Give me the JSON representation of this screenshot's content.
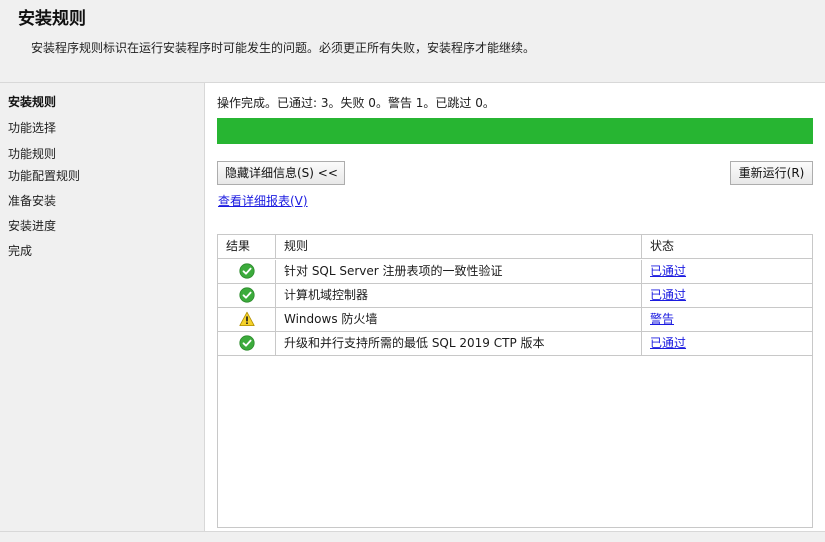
{
  "header": {
    "title": "安装规则",
    "description": "安装程序规则标识在运行安装程序时可能发生的问题。必须更正所有失败，安装程序才能继续。"
  },
  "sidebar": {
    "items": [
      {
        "label": "安装规则",
        "active": true
      },
      {
        "label": "功能选择",
        "active": false
      },
      {
        "label": "功能规则",
        "active": false
      },
      {
        "label": "功能配置规则",
        "active": false
      },
      {
        "label": "准备安装",
        "active": false
      },
      {
        "label": "安装进度",
        "active": false
      },
      {
        "label": "完成",
        "active": false
      }
    ]
  },
  "main": {
    "status_text": "操作完成。已通过: 3。失败 0。警告 1。已跳过 0。",
    "progress_percent": 100,
    "progress_color": "#27b532",
    "hide_details_label": "隐藏详细信息(S) <<",
    "rerun_label": "重新运行(R)",
    "report_link": "查看详细报表(V)",
    "table": {
      "headers": [
        "结果",
        "规则",
        "状态"
      ],
      "rows": [
        {
          "icon": "check-circle-icon",
          "rule": "针对 SQL Server 注册表项的一致性验证",
          "status": "已通过"
        },
        {
          "icon": "check-circle-icon",
          "rule": "计算机域控制器",
          "status": "已通过"
        },
        {
          "icon": "warning-icon",
          "rule": "Windows 防火墙",
          "status": "警告"
        },
        {
          "icon": "check-circle-icon",
          "rule": "升级和并行支持所需的最低 SQL 2019 CTP 版本",
          "status": "已通过"
        }
      ]
    }
  }
}
